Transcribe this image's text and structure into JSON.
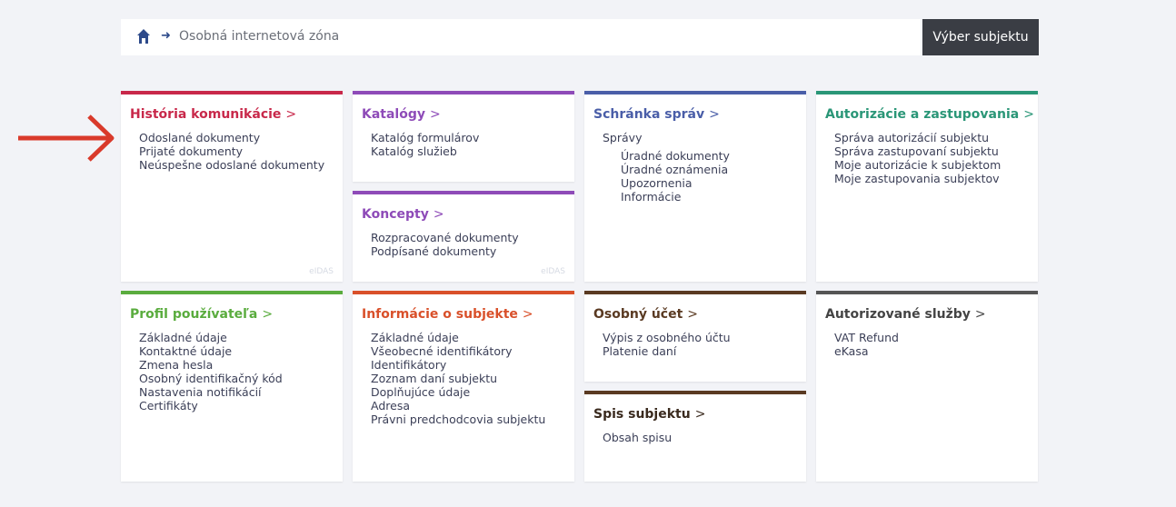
{
  "breadcrumb": {
    "text": "Osobná internetová zóna"
  },
  "select_subject_button": "Výber subjektu",
  "cards": {
    "historia": {
      "title": "História komunikácie",
      "color": "#c8284a",
      "items": [
        "Odoslané dokumenty",
        "Prijaté dokumenty",
        "Neúspešne odoslané dokumenty"
      ],
      "badge": "eIDAS"
    },
    "katalogy": {
      "title": "Katalógy",
      "color": "#8e4bb8",
      "items": [
        "Katalóg formulárov",
        "Katalóg služieb"
      ]
    },
    "koncepty": {
      "title": "Koncepty",
      "color": "#8e4bb8",
      "items": [
        "Rozpracované dokumenty",
        "Podpísané dokumenty"
      ],
      "badge": "eIDAS"
    },
    "schranka": {
      "title": "Schránka správ",
      "color": "#4a5ea8",
      "items": [
        "Správy",
        "Úradné dokumenty",
        "Úradné oznámenia",
        "Upozornenia",
        "Informácie"
      ]
    },
    "autorizacie": {
      "title": "Autorizácie a zastupovania",
      "color": "#2a9677",
      "items": [
        "Správa autorizácií subjektu",
        "Správa zastupovaní subjektu",
        "Moje autorizácie k subjektom",
        "Moje zastupovania subjektov"
      ]
    },
    "profil": {
      "title": "Profil používateľa",
      "color": "#5aac3e",
      "items": [
        "Základné údaje",
        "Kontaktné údaje",
        "Zmena hesla",
        "Osobný identifikačný kód",
        "Nastavenia notifikácií",
        "Certifikáty"
      ]
    },
    "informacie": {
      "title": "Informácie o subjekte",
      "color": "#d9502a",
      "items": [
        "Základné údaje",
        "Všeobecné identifikátory",
        "Identifikátory",
        "Zoznam daní subjektu",
        "Doplňujúce údaje",
        "Adresa",
        "Právni predchodcovia subjektu"
      ]
    },
    "ucet": {
      "title": "Osobný účet",
      "color": "#5a3a22",
      "items": [
        "Výpis z osobného účtu",
        "Platenie daní"
      ]
    },
    "spis": {
      "title": "Spis subjektu",
      "color": "#5a3a22",
      "items": [
        "Obsah spisu"
      ]
    },
    "autorizovane": {
      "title": "Autorizované služby",
      "color": "#555555",
      "items": [
        "VAT Refund",
        "eKasa"
      ]
    }
  },
  "colors": {
    "arrow": "#d93a2b"
  },
  "icons": {
    "home": "home-icon",
    "arrow": "right-arrow-icon"
  }
}
